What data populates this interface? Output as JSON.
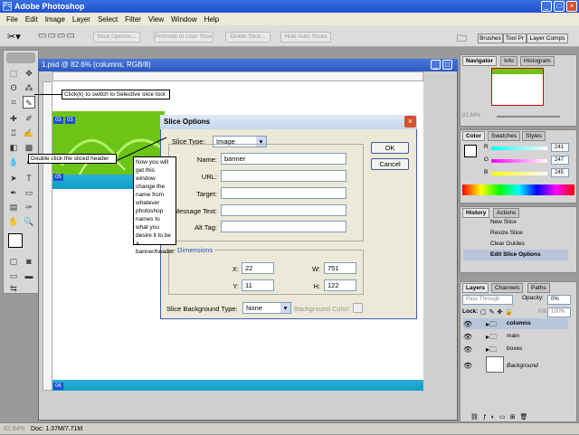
{
  "app": {
    "title": "Adobe Photoshop"
  },
  "menu": [
    "File",
    "Edit",
    "Image",
    "Layer",
    "Select",
    "Filter",
    "View",
    "Window",
    "Help"
  ],
  "options": {
    "buttons": [
      "Slice Options...",
      "Promote to User Slice",
      "Divide Slice...",
      "Hide Auto Slices"
    ],
    "palette_tabs": [
      "Brushes",
      "Tool Pr",
      "Layer Comps"
    ]
  },
  "document": {
    "title": "1.psd @ 82.6% (columns, RGB/8)"
  },
  "tooltips": {
    "slice_tool": "Click(k) to switch to Selective slice tool",
    "double_click": "Double click the sliced header",
    "instructions": "Now you will get this window change the name from whatever photoshop names to what you desire it to be a banner/header."
  },
  "slice_labels": [
    "03",
    "03",
    "05",
    "06"
  ],
  "dialog": {
    "title": "Slice Options",
    "slice_type_label": "Slice Type:",
    "slice_type_value": "Image",
    "name_label": "Name:",
    "name_value": "banner",
    "url_label": "URL:",
    "target_label": "Target:",
    "message_label": "Message Text:",
    "alt_label": "Alt Tag:",
    "dimensions_label": "Dimensions",
    "x_label": "X:",
    "x_value": "22",
    "y_label": "Y:",
    "y_value": "11",
    "w_label": "W:",
    "w_value": "751",
    "h_label": "H:",
    "h_value": "122",
    "bg_type_label": "Slice Background Type:",
    "bg_type_value": "None",
    "bg_color_label": "Background Color:",
    "ok_label": "OK",
    "cancel_label": "Cancel"
  },
  "navigator": {
    "tabs": [
      "Navigator",
      "Info",
      "Histogram"
    ],
    "zoom": "82.64%"
  },
  "color": {
    "tabs": [
      "Color",
      "Swatches",
      "Styles"
    ],
    "r": "241",
    "g": "247",
    "b": "245",
    "r_label": "R",
    "g_label": "G",
    "b_label": "B"
  },
  "history": {
    "tabs": [
      "History",
      "Actions"
    ],
    "items": [
      "New Slice",
      "Resize Slice",
      "Clear Guides",
      "Edit Slice Options"
    ]
  },
  "layers": {
    "tabs": [
      "Layers",
      "Channels",
      "Paths"
    ],
    "blend_mode": "Pass Through",
    "opacity_label": "Opacity:",
    "opacity": "0%",
    "lock_label": "Lock:",
    "fill_label": "Fill:",
    "fill": "100%",
    "items": [
      "columns",
      "main",
      "boxes",
      "Background"
    ]
  },
  "status": {
    "zoom": "82.64%",
    "doc": "Doc: 1.37M/7.71M"
  }
}
